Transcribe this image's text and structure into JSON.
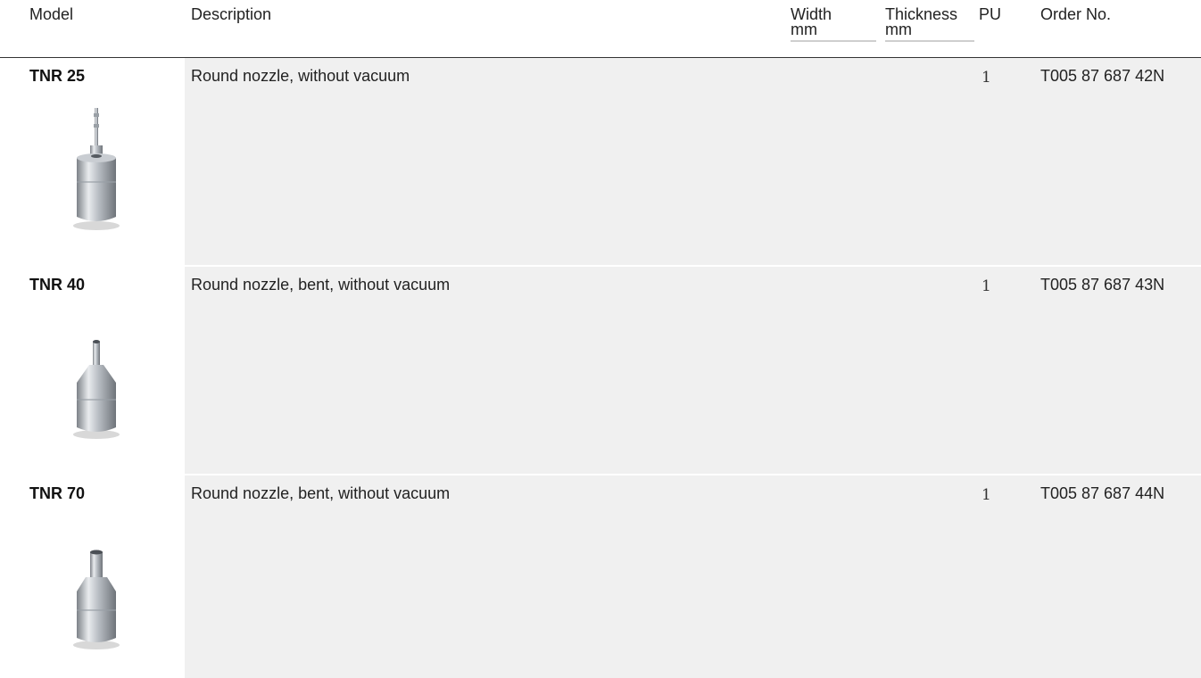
{
  "table": {
    "headers": {
      "model": "Model",
      "description": "Description",
      "width": "Width",
      "width_unit": "mm",
      "thickness": "Thickness",
      "thickness_unit": "mm",
      "pu": "PU",
      "order_no": "Order No."
    },
    "rows": [
      {
        "model": "TNR 25",
        "description": "Round nozzle, without vacuum",
        "width": "",
        "thickness": "",
        "pu": "1",
        "order_no": "T005 87 687 42N",
        "image": "round-nozzle-thin-tip-icon"
      },
      {
        "model": "TNR 40",
        "description": "Round nozzle, bent, without vacuum",
        "width": "",
        "thickness": "",
        "pu": "1",
        "order_no": "T005 87 687 43N",
        "image": "round-nozzle-medium-tip-icon"
      },
      {
        "model": "TNR 70",
        "description": "Round nozzle, bent, without vacuum",
        "width": "",
        "thickness": "",
        "pu": "1",
        "order_no": "T005 87 687 44N",
        "image": "round-nozzle-wide-tip-icon"
      }
    ]
  }
}
